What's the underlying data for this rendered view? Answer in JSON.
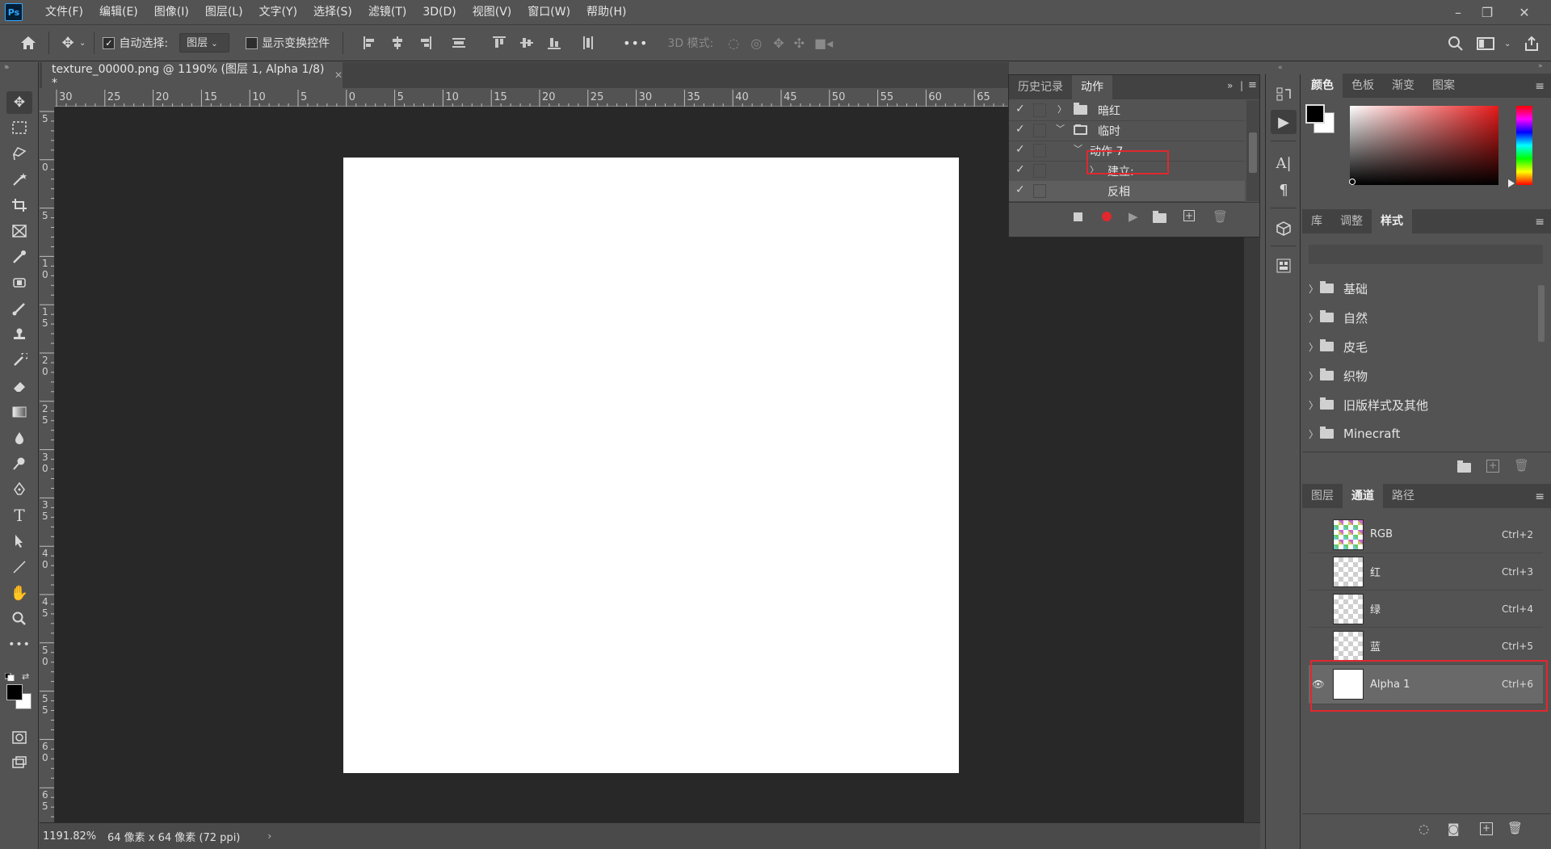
{
  "app": {
    "logo": "Ps"
  },
  "menubar": {
    "items": [
      "文件(F)",
      "编辑(E)",
      "图像(I)",
      "图层(L)",
      "文字(Y)",
      "选择(S)",
      "滤镜(T)",
      "3D(D)",
      "视图(V)",
      "窗口(W)",
      "帮助(H)"
    ]
  },
  "options": {
    "auto_select_label": "自动选择:",
    "auto_select_checked": true,
    "auto_select_value": "图层",
    "show_transform_label": "显示变换控件",
    "show_transform_checked": false,
    "mode_3d_label": "3D 模式:",
    "more_label": "•••"
  },
  "document": {
    "tab_title": "texture_00000.png @ 1190% (图层 1, Alpha 1/8) *",
    "zoom": "1191.82%",
    "info": "64 像素 x 64 像素 (72 ppi)"
  },
  "rulers": {
    "h_ticks": [
      "30",
      "25",
      "20",
      "15",
      "10",
      "5",
      "0",
      "5",
      "10",
      "15",
      "20",
      "25",
      "30",
      "35",
      "40",
      "45",
      "50",
      "55",
      "60",
      "65"
    ],
    "v_ticks": [
      "5",
      "0",
      "5",
      "1\n0",
      "1\n5",
      "2\n0",
      "2\n5",
      "3\n0",
      "3\n5",
      "4\n0",
      "4\n5",
      "5\n0",
      "5\n5",
      "6\n0",
      "6\n5"
    ]
  },
  "actions_panel": {
    "tabs": [
      "历史记录",
      "动作"
    ],
    "active_tab": "动作",
    "rows": [
      {
        "label": "暗红",
        "type": "set",
        "expanded": false
      },
      {
        "label": "临时",
        "type": "set",
        "expanded": true
      },
      {
        "label": "动作 7",
        "type": "action",
        "expanded": true
      },
      {
        "label": "建立:",
        "type": "step",
        "expanded": false
      },
      {
        "label": "反相",
        "type": "step",
        "highlighted": true
      }
    ]
  },
  "color_panel": {
    "tabs": [
      "颜色",
      "色板",
      "渐变",
      "图案"
    ],
    "active_tab": "颜色",
    "foreground": "#000000",
    "background": "#ffffff",
    "hue_color": "#e81a1a"
  },
  "styles_panel": {
    "tabs": [
      "库",
      "调整",
      "样式"
    ],
    "active_tab": "样式",
    "items": [
      "基础",
      "自然",
      "皮毛",
      "织物",
      "旧版样式及其他",
      "Minecraft"
    ]
  },
  "channels_panel": {
    "tabs": [
      "图层",
      "通道",
      "路径"
    ],
    "active_tab": "通道",
    "channels": [
      {
        "name": "RGB",
        "shortcut": "Ctrl+2",
        "visible": false
      },
      {
        "name": "红",
        "shortcut": "Ctrl+3",
        "visible": false
      },
      {
        "name": "绿",
        "shortcut": "Ctrl+4",
        "visible": false
      },
      {
        "name": "蓝",
        "shortcut": "Ctrl+5",
        "visible": false
      },
      {
        "name": "Alpha 1",
        "shortcut": "Ctrl+6",
        "visible": true,
        "selected": true
      }
    ]
  },
  "colors": {
    "highlight_red": "#e0282e",
    "record_red": "#e0282e",
    "panel_bg": "#535353",
    "canvas_bg": "#282828"
  }
}
